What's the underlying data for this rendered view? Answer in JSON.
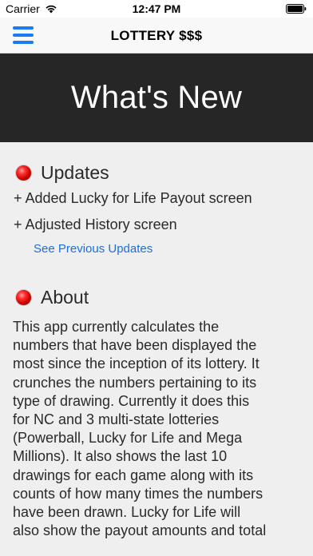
{
  "status_bar": {
    "carrier": "Carrier",
    "time": "12:47 PM"
  },
  "nav": {
    "title": "LOTTERY $$$"
  },
  "banner": {
    "title": "What's New"
  },
  "updates": {
    "heading": "Updates",
    "items": [
      "+ Added Lucky for Life Payout screen",
      "+ Adjusted History screen"
    ],
    "link_label": "See Previous Updates"
  },
  "about": {
    "heading": "About",
    "lines": [
      "This app currently calculates the",
      "numbers that have been displayed the",
      "most since the inception of its lottery. It",
      "crunches the numbers pertaining to its",
      "type of drawing. Currently it does this",
      "for NC and 3 multi-state lotteries",
      "(Powerball, Lucky for Life and Mega",
      "Millions). It also shows the last 10",
      "drawings for each game along with its",
      "counts of how many times the numbers",
      "have been drawn. Lucky for Life will",
      "also show the payout amounts and total"
    ]
  },
  "colors": {
    "accent": "#1a7cf0",
    "banner_bg": "#262626",
    "content_bg": "#efefef",
    "dot": "#e00000"
  }
}
